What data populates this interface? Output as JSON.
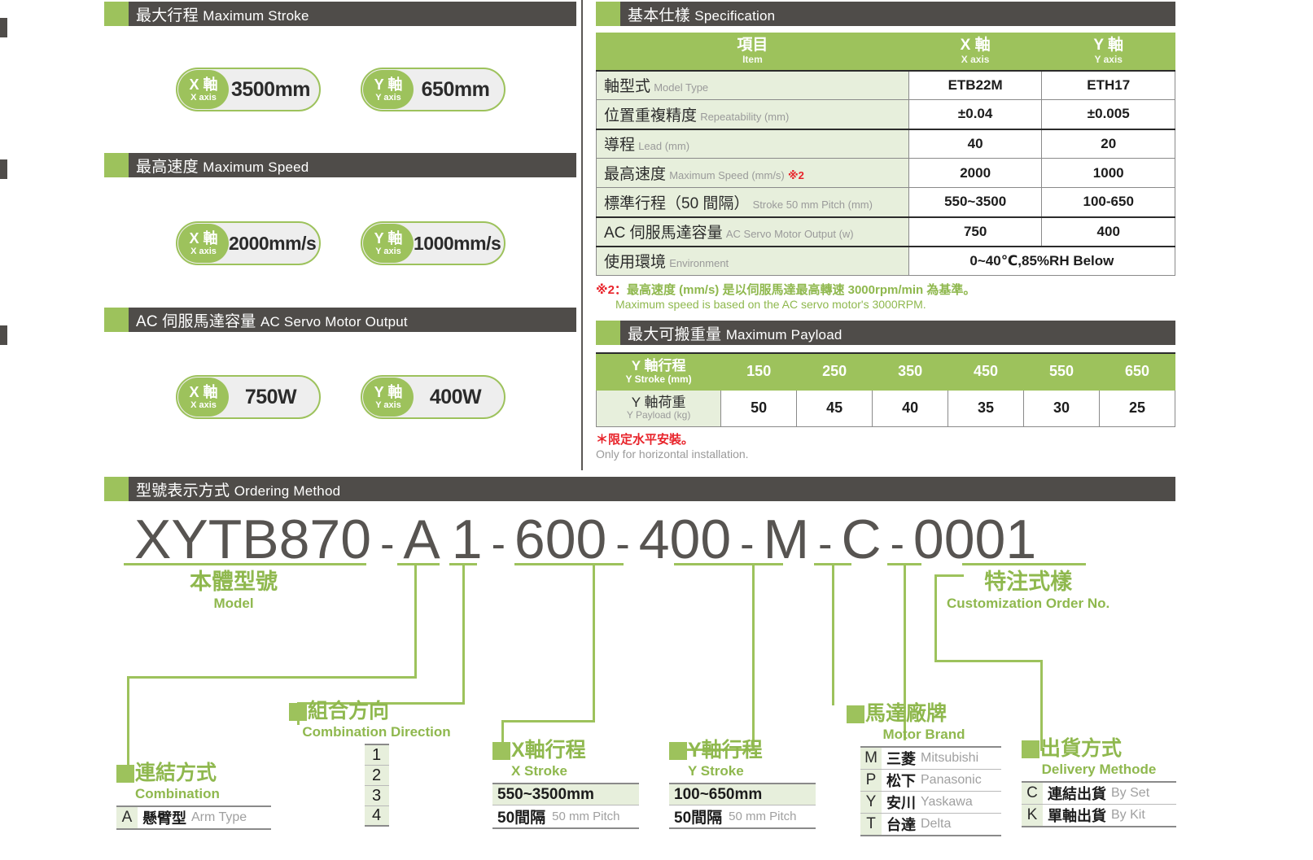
{
  "sections": {
    "max_stroke": {
      "cn": "最大行程",
      "en": "Maximum Stroke"
    },
    "max_speed": {
      "cn": "最高速度",
      "en": "Maximum Speed"
    },
    "motor_output": {
      "cn": "AC 伺服馬達容量",
      "en": "AC Servo Motor Output"
    },
    "spec": {
      "cn": "基本仕樣",
      "en": "Specification"
    },
    "payload": {
      "cn": "最大可搬重量",
      "en": "Maximum Payload"
    },
    "ordering": {
      "cn": "型號表示方式",
      "en": "Ordering Method"
    }
  },
  "badges": {
    "stroke_x": {
      "axis_cn": "X 軸",
      "axis_en": "X axis",
      "value": "3500mm"
    },
    "stroke_y": {
      "axis_cn": "Y 軸",
      "axis_en": "Y axis",
      "value": "650mm"
    },
    "speed_x": {
      "axis_cn": "X 軸",
      "axis_en": "X axis",
      "value": "2000mm/s"
    },
    "speed_y": {
      "axis_cn": "Y 軸",
      "axis_en": "Y axis",
      "value": "1000mm/s"
    },
    "motor_x": {
      "axis_cn": "X 軸",
      "axis_en": "X axis",
      "value": "750W"
    },
    "motor_y": {
      "axis_cn": "Y 軸",
      "axis_en": "Y axis",
      "value": "400W"
    }
  },
  "spec_table": {
    "headers": {
      "item": {
        "cn": "項目",
        "en": "Item"
      },
      "x_axis": {
        "cn": "X 軸",
        "en": "X axis"
      },
      "y_axis": {
        "cn": "Y 軸",
        "en": "Y axis"
      }
    },
    "rows": [
      {
        "cn": "軸型式",
        "en": "Model Type",
        "x": "ETB22M",
        "y": "ETH17"
      },
      {
        "cn": "位置重複精度",
        "en": "Repeatability (mm)",
        "x": "±0.04",
        "y": "±0.005"
      },
      {
        "cn": "導程",
        "en": "Lead (mm)",
        "x": "40",
        "y": "20"
      },
      {
        "cn": "最高速度",
        "en": "Maximum Speed (mm/s)",
        "note": "※2",
        "x": "2000",
        "y": "1000"
      },
      {
        "cn": "標準行程（50 間隔）",
        "en": "Stroke 50 mm Pitch (mm)",
        "x": "550~3500",
        "y": "100-650"
      },
      {
        "cn": "AC 伺服馬達容量",
        "en": "AC Servo Motor Output (w)",
        "x": "750",
        "y": "400"
      },
      {
        "cn": "使用環境",
        "en": "Environment",
        "span": "0~40℃,85%RH Below"
      }
    ]
  },
  "spec_note": {
    "marker": "※2：",
    "cn": "最高速度 (mm/s) 是以伺服馬達最高轉速 3000rpm/min 為基準。",
    "en": "Maximum speed is based on the AC servo motor's 3000RPM."
  },
  "payload_table": {
    "row_stroke": {
      "cn": "Y 軸行程",
      "en": "Y Stroke (mm)"
    },
    "row_load": {
      "cn": "Y 軸荷重",
      "en": "Y Payload (kg)"
    },
    "strokes": [
      "150",
      "250",
      "350",
      "450",
      "550",
      "650"
    ],
    "payloads": [
      "50",
      "45",
      "40",
      "35",
      "30",
      "25"
    ]
  },
  "payload_note": {
    "cn": "＊限定水平安裝。",
    "en": "Only for horizontal installation."
  },
  "chart_data": {
    "type": "bar",
    "title": "Maximum Payload",
    "xlabel": "Y Stroke (mm)",
    "ylabel": "Y Payload (kg)",
    "categories": [
      "150",
      "250",
      "350",
      "450",
      "550",
      "650"
    ],
    "values": [
      50,
      45,
      40,
      35,
      30,
      25
    ],
    "ylim": [
      0,
      50
    ]
  },
  "ordering": {
    "model_string": "XYTB870 - A 1 - 600 - 400 - M - C - 0001",
    "segments": [
      {
        "text": "XYTB870"
      },
      {
        "text": "A"
      },
      {
        "text": "1"
      },
      {
        "text": "600"
      },
      {
        "text": "400"
      },
      {
        "text": "M"
      },
      {
        "text": "C"
      },
      {
        "text": "0001"
      }
    ],
    "dash": "-",
    "labels": {
      "model": {
        "cn": "本體型號",
        "en": "Model"
      },
      "customization": {
        "cn": "特注式樣",
        "en": "Customization Order No."
      },
      "combination": {
        "cn": "連結方式",
        "en": "Combination"
      },
      "direction": {
        "cn": "組合方向",
        "en": "Combination Direction"
      },
      "x_stroke": {
        "cn": "X軸行程",
        "en": "X Stroke"
      },
      "y_stroke": {
        "cn": "Y軸行程",
        "en": "Y Stroke"
      },
      "motor_brand": {
        "cn": "馬達廠牌",
        "en": "Motor Brand"
      },
      "delivery": {
        "cn": "出貨方式",
        "en": "Delivery Methode"
      }
    },
    "combination_options": [
      {
        "key": "A",
        "cn": "懸臂型",
        "en": "Arm Type"
      }
    ],
    "direction_options": [
      "1",
      "2",
      "3",
      "4"
    ],
    "x_stroke_options": [
      {
        "cn": "550~3500mm",
        "en": ""
      },
      {
        "cn": "50間隔",
        "en": "50 mm Pitch"
      }
    ],
    "y_stroke_options": [
      {
        "cn": "100~650mm",
        "en": ""
      },
      {
        "cn": "50間隔",
        "en": "50 mm Pitch"
      }
    ],
    "motor_brand_options": [
      {
        "key": "M",
        "cn": "三菱",
        "en": "Mitsubishi"
      },
      {
        "key": "P",
        "cn": "松下",
        "en": "Panasonic"
      },
      {
        "key": "Y",
        "cn": "安川",
        "en": "Yaskawa"
      },
      {
        "key": "T",
        "cn": "台達",
        "en": "Delta"
      }
    ],
    "delivery_options": [
      {
        "key": "C",
        "cn": "連結出貨",
        "en": "By Set"
      },
      {
        "key": "K",
        "cn": "單軸出貨",
        "en": "By Kit"
      }
    ]
  },
  "colors": {
    "green": "#9dc25c",
    "green_text": "#8fb84e",
    "dark_bar": "#4f4c49",
    "light_green": "#e7efdc",
    "red": "#e8232a",
    "gray_text": "#9a9a9a"
  }
}
